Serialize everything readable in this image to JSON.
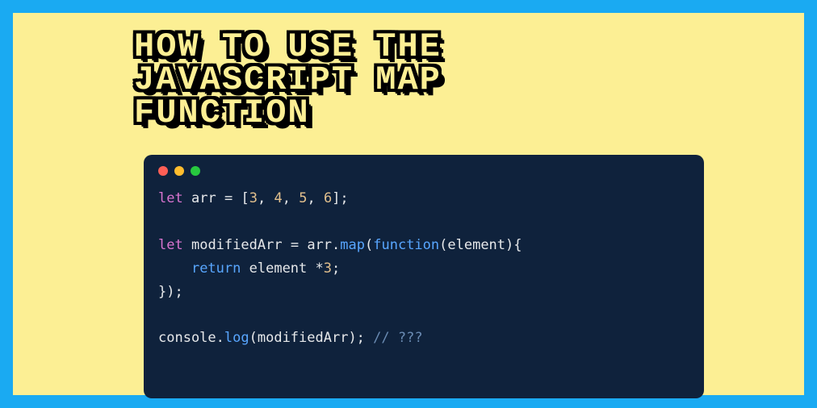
{
  "title_lines": [
    "How to use the",
    "JavaScript map",
    "function"
  ],
  "colors": {
    "border": "#1aaaf2",
    "canvas": "#fcef94",
    "editor_bg": "#0f223c",
    "dot_red": "#ff5f56",
    "dot_yellow": "#ffbd2e",
    "dot_green": "#27c93f"
  },
  "code": {
    "line1": {
      "kw": "let",
      "name": "arr",
      "assign": "=",
      "lb": "[",
      "n1": "3",
      "c1": ",",
      "n2": "4",
      "c2": ",",
      "n3": "5",
      "c3": ",",
      "n4": "6",
      "rb": "];"
    },
    "blank1": "",
    "line2": {
      "kw": "let",
      "name": "modifiedArr",
      "assign": "=",
      "obj": "arr",
      "dot": ".",
      "method": "map",
      "open": "(",
      "funckw": "function",
      "params": "(element){"
    },
    "line3": {
      "indent": "    ",
      "ret": "return",
      "expr_a": "element ",
      "star": "*",
      "expr_b": "3",
      "semi": ";"
    },
    "line4": {
      "close": "});"
    },
    "blank2": "",
    "line5": {
      "obj": "console",
      "dot": ".",
      "method": "log",
      "args": "(modifiedArr);",
      "comment": "// ???"
    }
  }
}
